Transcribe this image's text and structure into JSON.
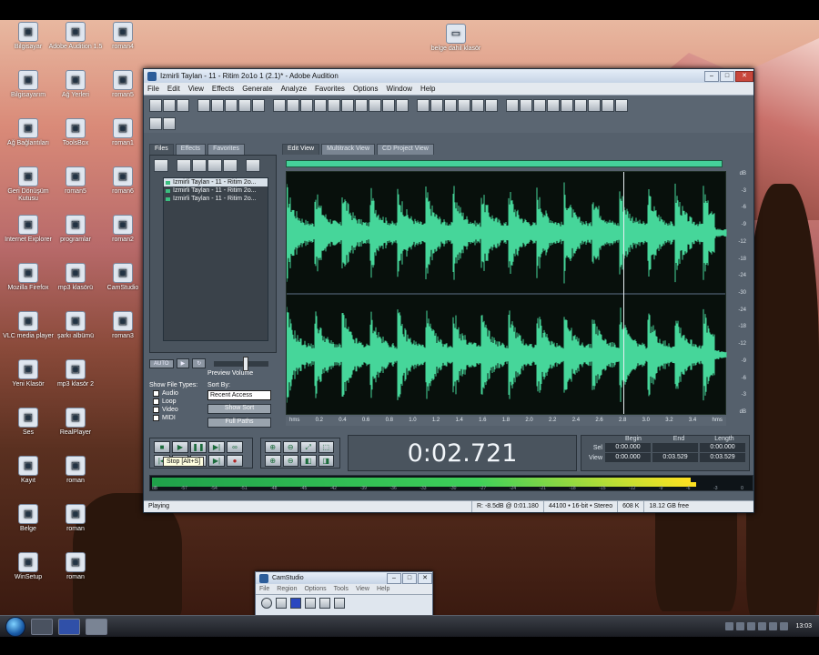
{
  "window": {
    "title": "Izmirli Taylan - 11 - Ritim 2o1o 1 (2.1)* - Adobe Audition",
    "menu": [
      "File",
      "Edit",
      "View",
      "Effects",
      "Generate",
      "Analyze",
      "Favorites",
      "Options",
      "Window",
      "Help"
    ]
  },
  "left_tabs": [
    "Files",
    "Effects",
    "Favorites"
  ],
  "files": [
    "Izmirli Taylan - 11 - Ritim 2o...",
    "Izmirli Taylan - 11 - Ritim 2o...",
    "Izmirli Taylan - 11 - Ritim 2o..."
  ],
  "preview": {
    "autoplay": "AUTO",
    "label": "Preview Volume"
  },
  "file_types": {
    "label": "Show File Types:",
    "items": [
      "Audio",
      "Loop",
      "Video",
      "MIDI"
    ]
  },
  "sort": {
    "label": "Sort By:",
    "value": "Recent Access",
    "asc_btn": "Show Sort",
    "full_btn": "Full Paths"
  },
  "view_tabs": [
    "Edit View",
    "Multitrack View",
    "CD Project View"
  ],
  "ruler": [
    "hms",
    "0.2",
    "0.4",
    "0.6",
    "0.8",
    "1.0",
    "1.2",
    "1.4",
    "1.6",
    "1.8",
    "2.0",
    "2.2",
    "2.4",
    "2.6",
    "2.8",
    "3.0",
    "3.2",
    "3.4",
    "hms"
  ],
  "db_scale": [
    "dB",
    "-3",
    "-6",
    "-9",
    "-12",
    "-18",
    "-24",
    "-30",
    "-24",
    "-18",
    "-12",
    "-9",
    "-6",
    "-3",
    "dB"
  ],
  "transport": {
    "tooltip": "Stop  [Alt+S]"
  },
  "time_display": "0:02.721",
  "selection": {
    "headers": [
      "Begin",
      "End",
      "Length"
    ],
    "sel_label": "Sel",
    "view_label": "View",
    "sel": [
      "0:00.000",
      "",
      "0:00.000"
    ],
    "view": [
      "0:00.000",
      "0:03.529",
      "0:03.529"
    ]
  },
  "level_scale": [
    "dB",
    "-57",
    "-54",
    "-51",
    "-48",
    "-45",
    "-42",
    "-39",
    "-36",
    "-33",
    "-30",
    "-27",
    "-24",
    "-21",
    "-18",
    "-15",
    "-12",
    "-9",
    "-6",
    "-3",
    "0"
  ],
  "status": {
    "state": "Playing",
    "readout": "R: -8.5dB @  0:01.180",
    "format": "44100 • 16-bit • Stereo",
    "size": "608 K",
    "free": "18.12 GB free"
  },
  "smallwin": {
    "title": "CamStudio",
    "menu": [
      "File",
      "Region",
      "Options",
      "Tools",
      "View",
      "Help"
    ]
  },
  "desktop_icons": [
    "Bilgisayar",
    "Adobe Audition 1.5",
    "roman4",
    "Bilgisayarım",
    "Ağ Yerleri",
    "roman5",
    "Ağ Bağlantıları",
    "ToolsBox",
    "roman1",
    "Geri Dönüşüm Kutusu",
    "roman5",
    "roman6",
    "Internet Explorer",
    "programlar",
    "roman2",
    "Mozilla Firefox",
    "mp3 klasörü",
    "CamStudio",
    "VLC media player",
    "şarkı albümü",
    "roman3",
    "Yeni Klasör",
    "mp3 klasör 2",
    "",
    "Ses",
    "RealPlayer",
    "",
    "Kayıt",
    "roman",
    "",
    "Belge",
    "roman",
    "",
    "WinSetup",
    "roman",
    ""
  ],
  "top_folder_icon": "belge dahil klasör",
  "clock": "13:03"
}
